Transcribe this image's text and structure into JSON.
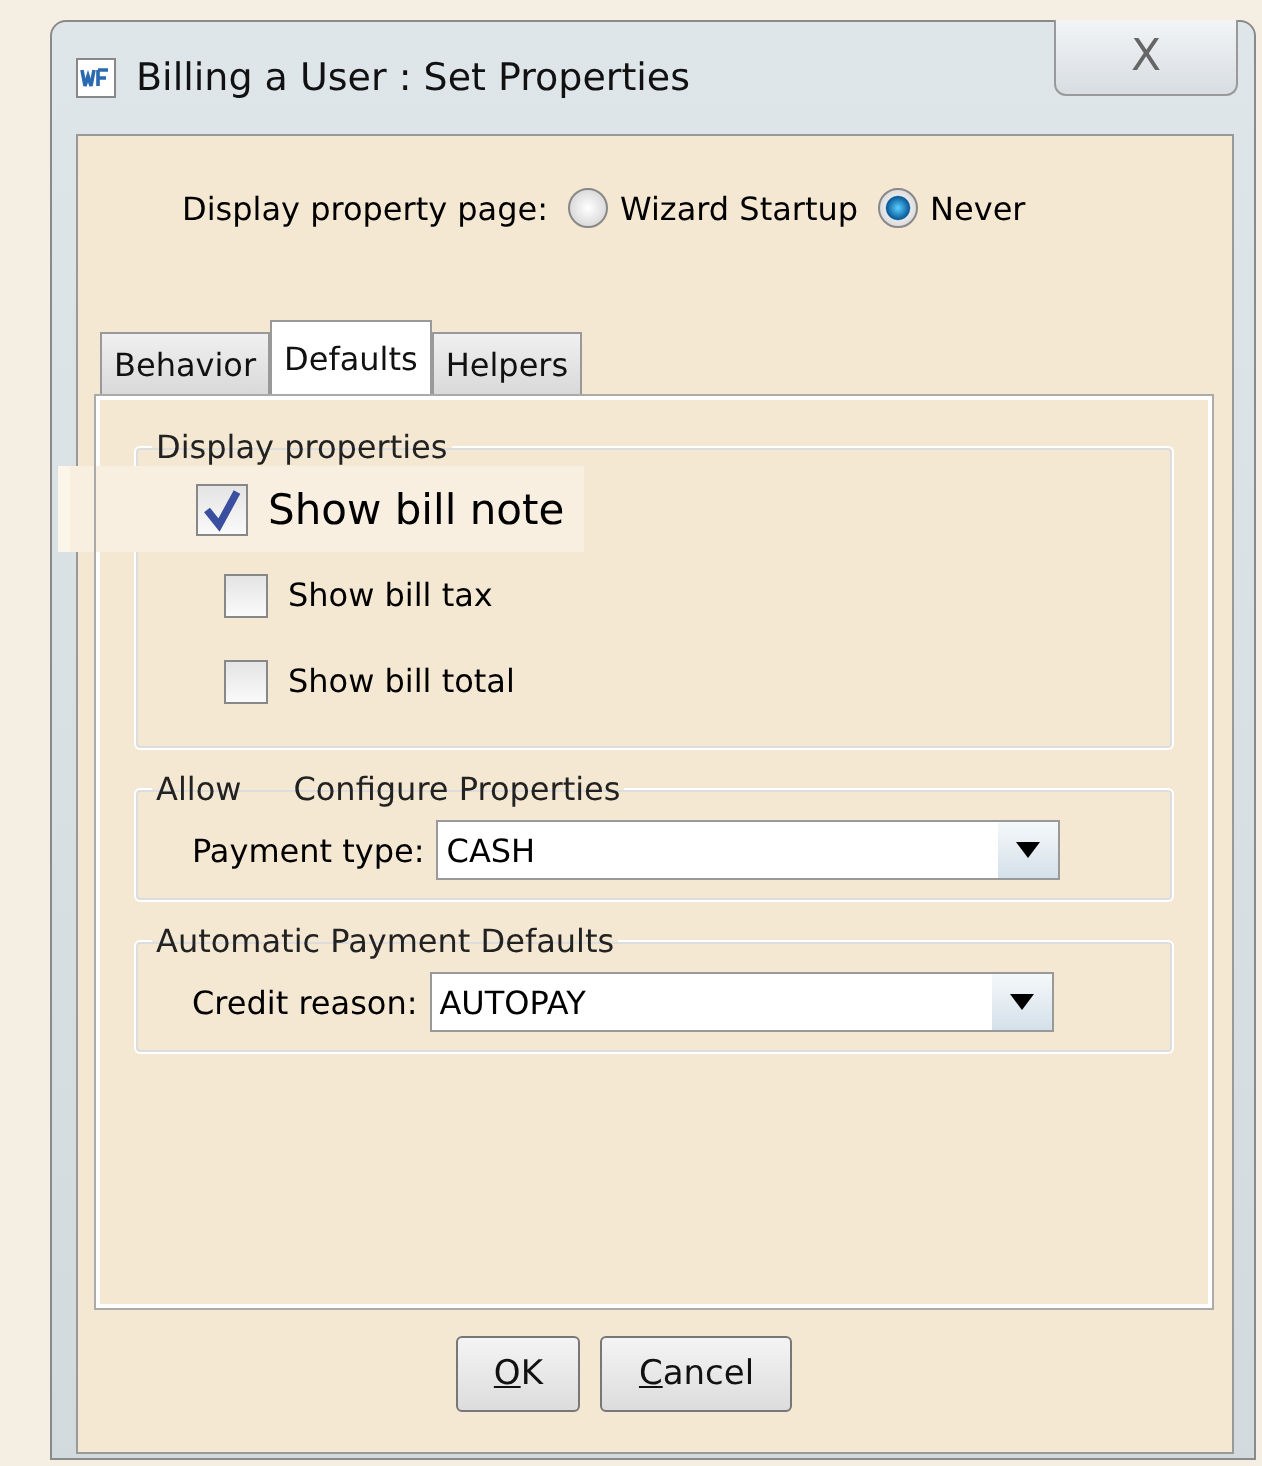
{
  "window": {
    "title": "Billing a User :  Set Properties",
    "close": "X"
  },
  "display_property_page": {
    "label": "Display property page:",
    "options": [
      {
        "label": "Wizard Startup",
        "selected": false
      },
      {
        "label": "Never",
        "selected": true
      }
    ]
  },
  "tabs": [
    {
      "label": "Behavior",
      "selected": false
    },
    {
      "label": "Defaults",
      "selected": true
    },
    {
      "label": "Helpers",
      "selected": false
    }
  ],
  "display_properties": {
    "title": "Display properties",
    "items": [
      {
        "label": "Show bill note",
        "checked": true,
        "focused": true
      },
      {
        "label": "Show bill tax",
        "checked": false,
        "focused": false
      },
      {
        "label": "Show bill total",
        "checked": false,
        "focused": false
      }
    ]
  },
  "groups": [
    {
      "title_parts": [
        "Allow",
        "Configure Properties"
      ],
      "label": "Payment type:",
      "value": "CASH"
    },
    {
      "title_parts": [
        "Automatic Payment Defaults"
      ],
      "label": "Credit reason:",
      "value": "AUTOPAY"
    }
  ],
  "buttons": [
    "OK",
    "Cancel"
  ]
}
